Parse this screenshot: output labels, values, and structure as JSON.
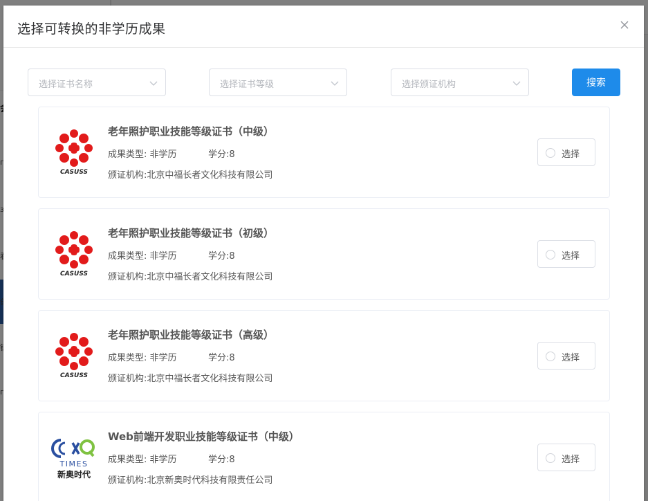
{
  "dialog": {
    "title": "选择可转换的非学历成果"
  },
  "filters": {
    "certificate_name_placeholder": "选择证书名称",
    "certificate_level_placeholder": "选择证书等级",
    "issuer_placeholder": "选择颁证机构",
    "search_label": "搜索"
  },
  "background": {
    "marks": [
      "会",
      "п",
      "з",
      "看",
      "创",
      "镇",
      "п"
    ]
  },
  "colors": {
    "primary": "#1e8bea",
    "logo_red": "#e21b1b",
    "times_blue": "#2a4fa0",
    "times_green": "#7fc241"
  },
  "results": [
    {
      "title": "老年照护职业技能等级证书（中级）",
      "type": "成果类型: 非学历",
      "credit": "学分:8",
      "issuer": "颁证机构:北京中福长者文化科技有限公司",
      "logo": "casuss-logo",
      "logo_text": "CASUSS",
      "select_label": "选择"
    },
    {
      "title": "老年照护职业技能等级证书（初级）",
      "type": "成果类型: 非学历",
      "credit": "学分:8",
      "issuer": "颁证机构:北京中福长者文化科技有限公司",
      "logo": "casuss-logo",
      "logo_text": "CASUSS",
      "select_label": "选择"
    },
    {
      "title": "老年照护职业技能等级证书（高级）",
      "type": "成果类型: 非学历",
      "credit": "学分:8",
      "issuer": "颁证机构:北京中福长者文化科技有限公司",
      "logo": "casuss-logo",
      "logo_text": "CASUSS",
      "select_label": "选择"
    },
    {
      "title": "Web前端开发职业技能等级证书（中级）",
      "type": "成果类型: 非学历",
      "credit": "学分:8",
      "issuer": "颁证机构:北京新奥时代科技有限责任公司",
      "logo": "xinao-times-logo",
      "logo_text": "TIMES",
      "logo_subtext": "新奥时代",
      "select_label": "选择"
    }
  ]
}
